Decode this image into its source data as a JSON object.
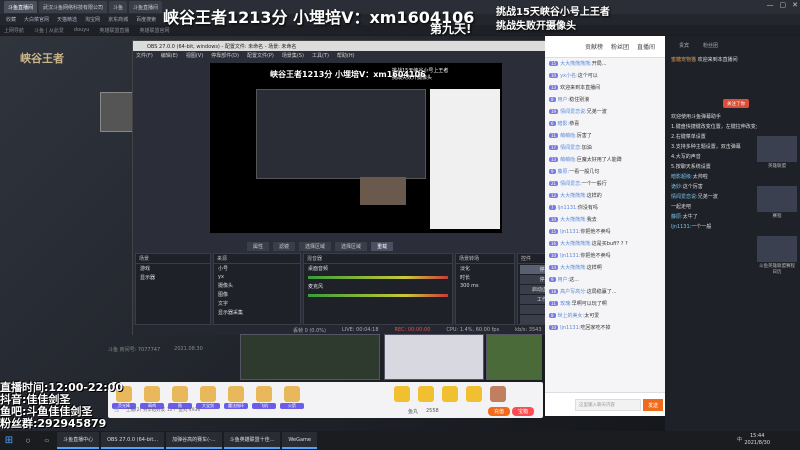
{
  "browser": {
    "tabs": [
      "斗鱼直播间",
      "武汉斗鱼网络科技有限公司",
      "斗鱼",
      "斗鱼直播间"
    ],
    "bookmarks": [
      "收藏",
      "大白菜官网",
      "天猫精选",
      "淘宝网",
      "京东商城",
      "百度搜索"
    ],
    "nav": [
      "上网导航",
      "斗鱼 | 从此爱",
      "douyu",
      "英雄联盟直播",
      "英雄联盟官网"
    ]
  },
  "overlay": {
    "title": "峡谷王者1213分  小埋培V：xm1604106",
    "day": "第九天!",
    "challenge_1": "挑战15天峡谷小号上王者",
    "challenge_2": "挑战失败开摄像头"
  },
  "room": {
    "logo": "峡谷王者"
  },
  "obs": {
    "title": "OBS 27.0.0 (64-bit, windows) - 配置文件: 未命名 - 场景: 未命名",
    "menu": [
      "文件(F)",
      "编辑(E)",
      "视图(V)",
      "停靠部件(D)",
      "配置文件(P)",
      "场景集(S)",
      "工具(T)",
      "帮助(H)"
    ],
    "preview": {
      "title": "峡谷王者1213分  小埋培V：xm1604106",
      "challenge_1": "挑战15天峡谷小号上王者",
      "challenge_2": "挑战失败开摄像头"
    },
    "tabs": [
      {
        "label": "属性"
      },
      {
        "label": "滤镜"
      },
      {
        "label": "选择区域"
      },
      {
        "label": "选择区域"
      },
      {
        "label": "重载"
      }
    ],
    "docks": {
      "scenes": {
        "header": "场景",
        "items": [
          "游戏",
          "显示器"
        ]
      },
      "sources": {
        "header": "来源",
        "items": [
          "小号",
          "yx",
          "摄像头",
          "图像",
          "文字",
          "显示器采集"
        ]
      },
      "mixer": {
        "header": "混音器",
        "items": [
          "桌面音频",
          "麦克风"
        ]
      },
      "transitions": {
        "header": "场景转场",
        "fade": "淡化",
        "duration_label": "时长",
        "duration_value": "300 ms"
      },
      "controls": {
        "header": "控件",
        "buttons": [
          "停止直播",
          "停止录制",
          "启动虚拟摄像机",
          "工作室模式",
          "设置",
          "退出"
        ]
      }
    },
    "status": {
      "dropped": "丢帧 0 (0.0%)",
      "live": "LIVE: 00:04:18",
      "rec": "REC: 00:00:00",
      "cpu": "CPU: 1.4%, 60.00 fps",
      "bitrate": "kb/s: 3543"
    }
  },
  "stream_info": {
    "room": "斗鱼 房间号: 7077747",
    "date": "2021.08.30"
  },
  "gifts": [
    {
      "label": "荧光棒"
    },
    {
      "label": "弱鸡"
    },
    {
      "label": "稳"
    },
    {
      "label": "大宝剑"
    },
    {
      "label": "魔法指环"
    },
    {
      "label": "飞机"
    },
    {
      "label": "火箭"
    }
  ],
  "fishball": {
    "label": "鱼丸",
    "value": "2558"
  },
  "buttons": {
    "recharge": "充值",
    "treasure": "宝箱"
  },
  "subscribe": {
    "label": "上播(2)",
    "text": "分享给好友  12个 鱼丸 4936"
  },
  "stats": {
    "time": "直播时间:12:00-22:00",
    "douyin": "抖音:佳佳剑圣",
    "fish": "鱼吧:斗鱼佳佳剑圣",
    "qq": "粉丝群:292945879"
  },
  "chat": {
    "header": {
      "rank": "贡献榜",
      "fans": "粉丝团",
      "title": "直播间"
    },
    "messages": [
      {
        "level": "15",
        "user": "大大熊熊熊熊:",
        "text": "开局..."
      },
      {
        "level": "10",
        "user": "yx小名:",
        "text": "这个可以"
      },
      {
        "level": "13",
        "user": "",
        "text": "欢迎来到本直播间"
      },
      {
        "level": "8",
        "user": "用户:",
        "text": "稳住别浪"
      },
      {
        "level": "19",
        "user": "情闻爱恋说:",
        "text": "兄弟一波"
      },
      {
        "level": "6",
        "user": "暗影:",
        "text": "恭喜"
      },
      {
        "level": "11",
        "user": "萌萌哒:",
        "text": "厉害了"
      },
      {
        "level": "17",
        "user": "情闻爱恋:",
        "text": "加油"
      },
      {
        "level": "13",
        "user": "萌萌哒:",
        "text": "巨魔太好用了人能蹲"
      },
      {
        "level": "9",
        "user": "藤原:",
        "text": "一看一般几句"
      },
      {
        "level": "21",
        "user": "情闻爱恋:",
        "text": "一个一般行"
      },
      {
        "level": "12",
        "user": "大大熊熊熊:",
        "text": "这样的"
      },
      {
        "level": "7",
        "user": "ljn1131:",
        "text": "你没有吗"
      },
      {
        "level": "10",
        "user": "大大熊熊熊:",
        "text": "我去"
      },
      {
        "level": "15",
        "user": "ljn1131:",
        "text": "你把他不卖吗"
      },
      {
        "level": "16",
        "user": "大大熊熊熊熊:",
        "text": "这是买buff? ? ?"
      },
      {
        "level": "10",
        "user": "ljn1131:",
        "text": "你把他不卖吗"
      },
      {
        "level": "14",
        "user": "大大熊熊熊:",
        "text": "这样啊"
      },
      {
        "level": "9",
        "user": "用户:",
        "text": "这..."
      },
      {
        "level": "18",
        "user": "高户写高分:",
        "text": "这局稳赢了..."
      },
      {
        "level": "11",
        "user": "玫瑰:",
        "text": "早啊可以玩了啊"
      },
      {
        "level": "8",
        "user": "世上的美女:",
        "text": "太可爱"
      },
      {
        "level": "10",
        "user": "ljn1131:",
        "text": "吃回家吃不掉"
      }
    ],
    "input_placeholder": "这里输入聊天内容",
    "send": "发送"
  },
  "rpanel": {
    "tabs": [
      "贵宾",
      "粉丝团"
    ],
    "welcome_name": "蜜糖宠物猫",
    "welcome_text": "欢迎来到本直播间",
    "follow_btn": "关注了你",
    "messages": [
      {
        "name": "",
        "text": "欢迎使用斗鱼弹幕助手"
      },
      {
        "name": "",
        "text": "1.键盘快捷键改变位置，左键拉伸改变大小"
      },
      {
        "name": "",
        "text": "2.右键菜单设置"
      },
      {
        "name": "",
        "text": "3.支持多种主题设置，双击弹幕"
      },
      {
        "name": "",
        "text": "4.大写的声音"
      },
      {
        "name": "",
        "text": "5.按聊天系统设置"
      },
      {
        "name": "暗影超级:",
        "text": "太帅啦"
      },
      {
        "name": "诡妙:",
        "text": "这个厉害"
      },
      {
        "name": "情闻爱恋说:",
        "text": "兄弟一波"
      },
      {
        "name": "",
        "text": "一起走吧"
      },
      {
        "name": "藤原:",
        "text": "太牛了"
      },
      {
        "name": "ljn1131:",
        "text": "一个一般"
      }
    ],
    "ads": [
      "英雄联盟",
      "赛程",
      "斗鱼英雄联盟赛程日历"
    ]
  },
  "taskbar": {
    "items": [
      "斗鱼直播中心",
      "OBS 27.0.0 (64-bit...",
      "加弹谷高的赛车(-...",
      "斗鱼英雄联盟十佳...",
      "WeGame"
    ],
    "lang": "中",
    "time": "15:44",
    "date": "2021/8/30"
  }
}
